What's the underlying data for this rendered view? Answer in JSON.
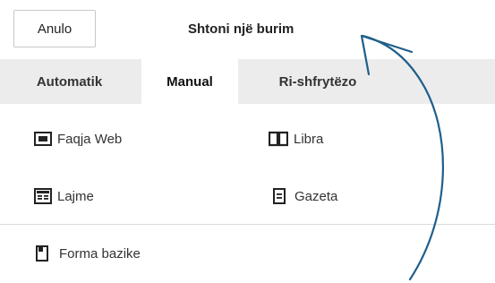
{
  "header": {
    "cancel_label": "Anulo",
    "title": "Shtoni një burim"
  },
  "tabs": [
    {
      "label": "Automatik",
      "active": false
    },
    {
      "label": "Manual",
      "active": true
    },
    {
      "label": "Ri-shfrytëzo",
      "active": false
    }
  ],
  "source_types": [
    {
      "label": "Faqja Web",
      "icon": "webpage-icon"
    },
    {
      "label": "Libra",
      "icon": "book-icon"
    },
    {
      "label": "Lajme",
      "icon": "news-icon"
    },
    {
      "label": "Gazeta",
      "icon": "journal-icon"
    },
    {
      "label": "Forma bazike",
      "icon": "basic-form-icon"
    }
  ],
  "colors": {
    "tab_bar": "#ececec",
    "annotation_arrow": "#1f5f8b"
  }
}
